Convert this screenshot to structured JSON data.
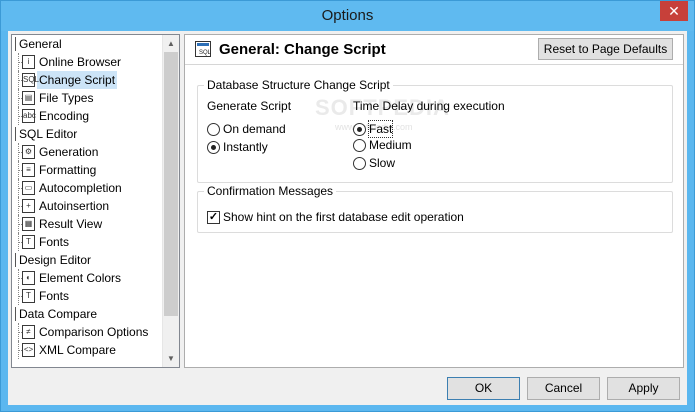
{
  "window": {
    "title": "Options",
    "close_glyph": "✕"
  },
  "tree": {
    "rows": [
      {
        "kind": "category",
        "label": "General"
      },
      {
        "kind": "item",
        "label": "Online Browser",
        "icon": "online-browser-icon",
        "glyph": "i"
      },
      {
        "kind": "item",
        "label": "Change Script",
        "icon": "change-script-icon",
        "glyph": "SQL",
        "selected": true
      },
      {
        "kind": "item",
        "label": "File Types",
        "icon": "file-types-icon",
        "glyph": "▤"
      },
      {
        "kind": "item",
        "label": "Encoding",
        "icon": "encoding-icon",
        "glyph": "abc"
      },
      {
        "kind": "category",
        "label": "SQL Editor"
      },
      {
        "kind": "item",
        "label": "Generation",
        "icon": "generation-icon",
        "glyph": "⚙"
      },
      {
        "kind": "item",
        "label": "Formatting",
        "icon": "formatting-icon",
        "glyph": "≡"
      },
      {
        "kind": "item",
        "label": "Autocompletion",
        "icon": "autocompletion-icon",
        "glyph": "▭"
      },
      {
        "kind": "item",
        "label": "Autoinsertion",
        "icon": "autoinsertion-icon",
        "glyph": "+"
      },
      {
        "kind": "item",
        "label": "Result View",
        "icon": "result-view-icon",
        "glyph": "▦"
      },
      {
        "kind": "item",
        "label": "Fonts",
        "icon": "fonts-icon",
        "glyph": "T"
      },
      {
        "kind": "category",
        "label": "Design Editor"
      },
      {
        "kind": "item",
        "label": "Element Colors",
        "icon": "element-colors-icon",
        "glyph": "◐"
      },
      {
        "kind": "item",
        "label": "Fonts",
        "icon": "fonts-icon",
        "glyph": "T"
      },
      {
        "kind": "category",
        "label": "Data Compare"
      },
      {
        "kind": "item",
        "label": "Comparison Options",
        "icon": "comparison-options-icon",
        "glyph": "≠"
      },
      {
        "kind": "item",
        "label": "XML Compare",
        "icon": "xml-compare-icon",
        "glyph": "<>"
      }
    ]
  },
  "panel": {
    "title": "General: Change Script",
    "reset_label": "Reset to Page Defaults",
    "group1": {
      "label": "Database Structure Change Script",
      "generate_label": "Generate Script",
      "generate_options": [
        {
          "label": "On demand",
          "checked": false
        },
        {
          "label": "Instantly",
          "checked": true
        }
      ],
      "delay_label": "Time Delay during execution",
      "delay_options": [
        {
          "label": "Fast",
          "checked": true
        },
        {
          "label": "Medium",
          "checked": false
        },
        {
          "label": "Slow",
          "checked": false
        }
      ]
    },
    "group2": {
      "label": "Confirmation Messages",
      "checkbox_label": "Show hint on the first database edit operation",
      "checked": true
    },
    "watermark": "SOFTPEDIA",
    "watermark_sub": "www.softpedia.com"
  },
  "footer": {
    "ok_label": "OK",
    "cancel_label": "Cancel",
    "apply_label": "Apply"
  }
}
